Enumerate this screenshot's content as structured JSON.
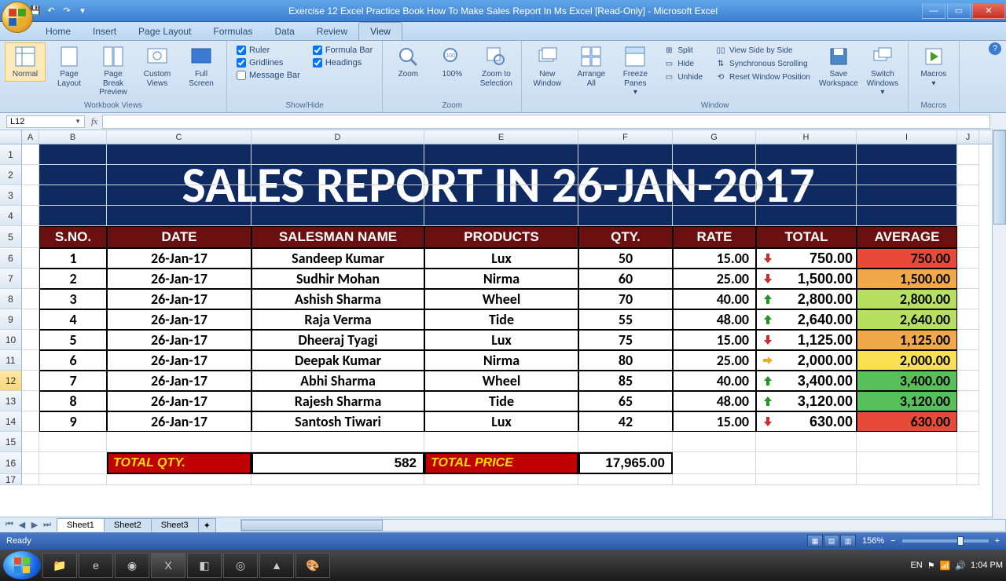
{
  "window": {
    "title": "Exercise 12  Excel Practice Book  How To Make Sales Report In Ms Excel  [Read-Only] - Microsoft Excel"
  },
  "tabs": {
    "home": "Home",
    "insert": "Insert",
    "pageLayout": "Page Layout",
    "formulas": "Formulas",
    "data": "Data",
    "review": "Review",
    "view": "View"
  },
  "ribbon": {
    "workbookViews": {
      "label": "Workbook Views",
      "normal": "Normal",
      "pageLayout": "Page Layout",
      "pageBreak": "Page Break Preview",
      "custom": "Custom Views",
      "full": "Full Screen"
    },
    "showHide": {
      "label": "Show/Hide",
      "ruler": "Ruler",
      "gridlines": "Gridlines",
      "msgbar": "Message Bar",
      "formulabar": "Formula Bar",
      "headings": "Headings"
    },
    "zoom": {
      "label": "Zoom",
      "zoom": "Zoom",
      "p100": "100%",
      "zts": "Zoom to Selection"
    },
    "window": {
      "label": "Window",
      "neww": "New Window",
      "arrange": "Arrange All",
      "freeze": "Freeze Panes",
      "split": "Split",
      "hide": "Hide",
      "unhide": "Unhide",
      "sbs": "View Side by Side",
      "sync": "Synchronous Scrolling",
      "reset": "Reset Window Position",
      "savews": "Save Workspace",
      "switch": "Switch Windows"
    },
    "macros": {
      "label": "Macros",
      "macros": "Macros"
    }
  },
  "namebox": "L12",
  "columns": [
    "A",
    "B",
    "C",
    "D",
    "E",
    "F",
    "G",
    "H",
    "I",
    "J"
  ],
  "banner": "SALES REPORT IN 26-JAN-2017",
  "headers": {
    "sno": "S.NO.",
    "date": "DATE",
    "salesman": "SALESMAN NAME",
    "products": "PRODUCTS",
    "qty": "QTY.",
    "rate": "RATE",
    "total": "TOTAL",
    "avg": "AVERAGE"
  },
  "rows": [
    {
      "sno": "1",
      "date": "26-Jan-17",
      "name": "Sandeep Kumar",
      "prod": "Lux",
      "qty": "50",
      "rate": "15.00",
      "dir": "down",
      "total": "750.00",
      "avg": "750.00",
      "avgCls": "avg-red"
    },
    {
      "sno": "2",
      "date": "26-Jan-17",
      "name": "Sudhir Mohan",
      "prod": "Nirma",
      "qty": "60",
      "rate": "25.00",
      "dir": "down",
      "total": "1,500.00",
      "avg": "1,500.00",
      "avgCls": "avg-orange"
    },
    {
      "sno": "3",
      "date": "26-Jan-17",
      "name": "Ashish Sharma",
      "prod": "Wheel",
      "qty": "70",
      "rate": "40.00",
      "dir": "up",
      "total": "2,800.00",
      "avg": "2,800.00",
      "avgCls": "avg-lime"
    },
    {
      "sno": "4",
      "date": "26-Jan-17",
      "name": "Raja Verma",
      "prod": "Tide",
      "qty": "55",
      "rate": "48.00",
      "dir": "up",
      "total": "2,640.00",
      "avg": "2,640.00",
      "avgCls": "avg-lime"
    },
    {
      "sno": "5",
      "date": "26-Jan-17",
      "name": "Dheeraj Tyagi",
      "prod": "Lux",
      "qty": "75",
      "rate": "15.00",
      "dir": "down",
      "total": "1,125.00",
      "avg": "1,125.00",
      "avgCls": "avg-orange"
    },
    {
      "sno": "6",
      "date": "26-Jan-17",
      "name": "Deepak Kumar",
      "prod": "Nirma",
      "qty": "80",
      "rate": "25.00",
      "dir": "right",
      "total": "2,000.00",
      "avg": "2,000.00",
      "avgCls": "avg-yellow"
    },
    {
      "sno": "7",
      "date": "26-Jan-17",
      "name": "Abhi Sharma",
      "prod": "Wheel",
      "qty": "85",
      "rate": "40.00",
      "dir": "up",
      "total": "3,400.00",
      "avg": "3,400.00",
      "avgCls": "avg-green"
    },
    {
      "sno": "8",
      "date": "26-Jan-17",
      "name": "Rajesh Sharma",
      "prod": "Tide",
      "qty": "65",
      "rate": "48.00",
      "dir": "up",
      "total": "3,120.00",
      "avg": "3,120.00",
      "avgCls": "avg-green"
    },
    {
      "sno": "9",
      "date": "26-Jan-17",
      "name": "Santosh Tiwari",
      "prod": "Lux",
      "qty": "42",
      "rate": "15.00",
      "dir": "down",
      "total": "630.00",
      "avg": "630.00",
      "avgCls": "avg-red"
    }
  ],
  "totals": {
    "qtyLabel": "TOTAL QTY.",
    "qtyVal": "582",
    "priceLabel": "TOTAL PRICE",
    "priceVal": "17,965.00"
  },
  "sheets": {
    "s1": "Sheet1",
    "s2": "Sheet2",
    "s3": "Sheet3"
  },
  "status": {
    "ready": "Ready",
    "zoom": "156%",
    "lang": "EN",
    "time": "1:04 PM"
  }
}
